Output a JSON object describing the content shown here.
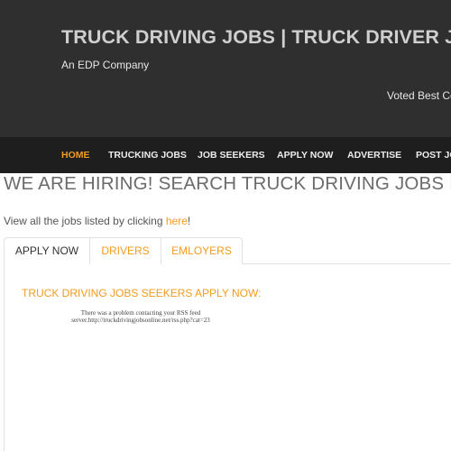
{
  "header": {
    "title": "TRUCK DRIVING JOBS | TRUCK DRIVER JOBS",
    "tagline": "An EDP Company",
    "voted": "Voted Best Company"
  },
  "nav": {
    "items": [
      {
        "label": "HOME",
        "active": true
      },
      {
        "label": "TRUCKING JOBS",
        "active": false
      },
      {
        "label": "JOB SEEKERS",
        "active": false
      },
      {
        "label": "APPLY NOW",
        "active": false
      },
      {
        "label": "ADVERTISE",
        "active": false
      },
      {
        "label": "POST JOBS",
        "active": false
      }
    ]
  },
  "main": {
    "heading": "WE ARE HIRING! SEARCH TRUCK DRIVING JOBS NOW",
    "intro_text": "View all the jobs listed by clicking ",
    "intro_link": "here",
    "intro_end": "!"
  },
  "tabs": [
    {
      "label": "APPLY NOW",
      "active": true
    },
    {
      "label": "DRIVERS",
      "active": false
    },
    {
      "label": "EMLOYERS",
      "active": false
    }
  ],
  "panel": {
    "heading": "TRUCK DRIVING JOBS SEEKERS APPLY NOW:",
    "rss_error": "There was a problem contacting your RSS feed server.http://truckdrivingjobsonline.net/rss.php?cat=23"
  },
  "colors": {
    "accent": "#f39c1f",
    "header_bg": "#2f2f2f",
    "nav_bg": "#1e1e1e"
  }
}
